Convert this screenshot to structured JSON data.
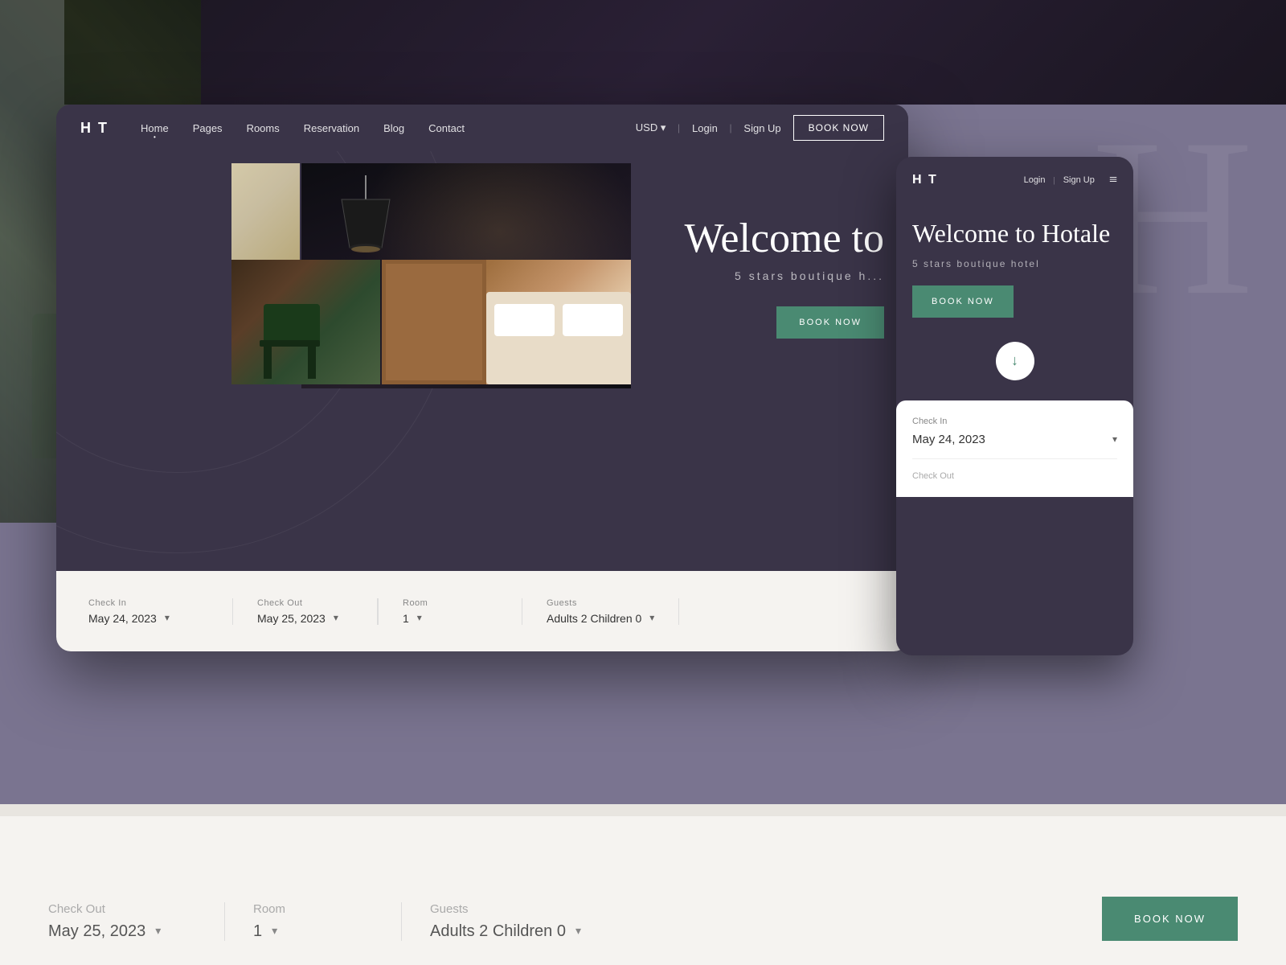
{
  "page": {
    "background_color": "#7a7490"
  },
  "desktop_mockup": {
    "logo": "H T",
    "nav": {
      "links": [
        "Home",
        "Pages",
        "Rooms",
        "Reservation",
        "Blog",
        "Contact"
      ],
      "active": "Home",
      "currency": "USD ▾",
      "login": "Login",
      "signup": "Sign Up",
      "book_btn": "BOOK NOW"
    },
    "hero": {
      "title": "Welcome to",
      "subtitle": "5 stars boutique h...",
      "book_btn": "BOOK NOW"
    },
    "booking_bar": {
      "fields": [
        {
          "label": "Check In",
          "value": "May 24, 2023",
          "has_arrow": true
        },
        {
          "label": "Check Out",
          "value": "May 25, 2023",
          "has_arrow": true
        },
        {
          "label": "Room",
          "value": "1",
          "has_arrow": true
        },
        {
          "label": "Guests",
          "value": "Adults 2   Children 0",
          "has_arrow": true
        }
      ]
    }
  },
  "mobile_mockup": {
    "logo": "H T",
    "nav": {
      "login": "Login",
      "divider": "|",
      "signup": "Sign Up",
      "menu_icon": "≡"
    },
    "hero": {
      "title": "Welcome to Hotale",
      "subtitle": "5 stars boutique hotel",
      "book_btn": "BOOK NOW",
      "scroll_arrow": "↓"
    },
    "booking": {
      "checkin_label": "Check In",
      "checkin_value": "May 24, 2023",
      "checkin_arrow": "▾",
      "checkout_label": "Check Out"
    }
  },
  "bottom_bar": {
    "checkout_label": "Check Out",
    "checkout_value": "May 25, 2023",
    "checkout_arrow": "▾",
    "room_label": "Room",
    "room_value": "1",
    "room_arrow": "▾",
    "guests_label": "Guests",
    "guests_value": "Adults 2   Children 0",
    "guests_arrow": "▾",
    "book_btn": "BOOK NOW"
  },
  "large_bg_text": {
    "letter": "H"
  }
}
